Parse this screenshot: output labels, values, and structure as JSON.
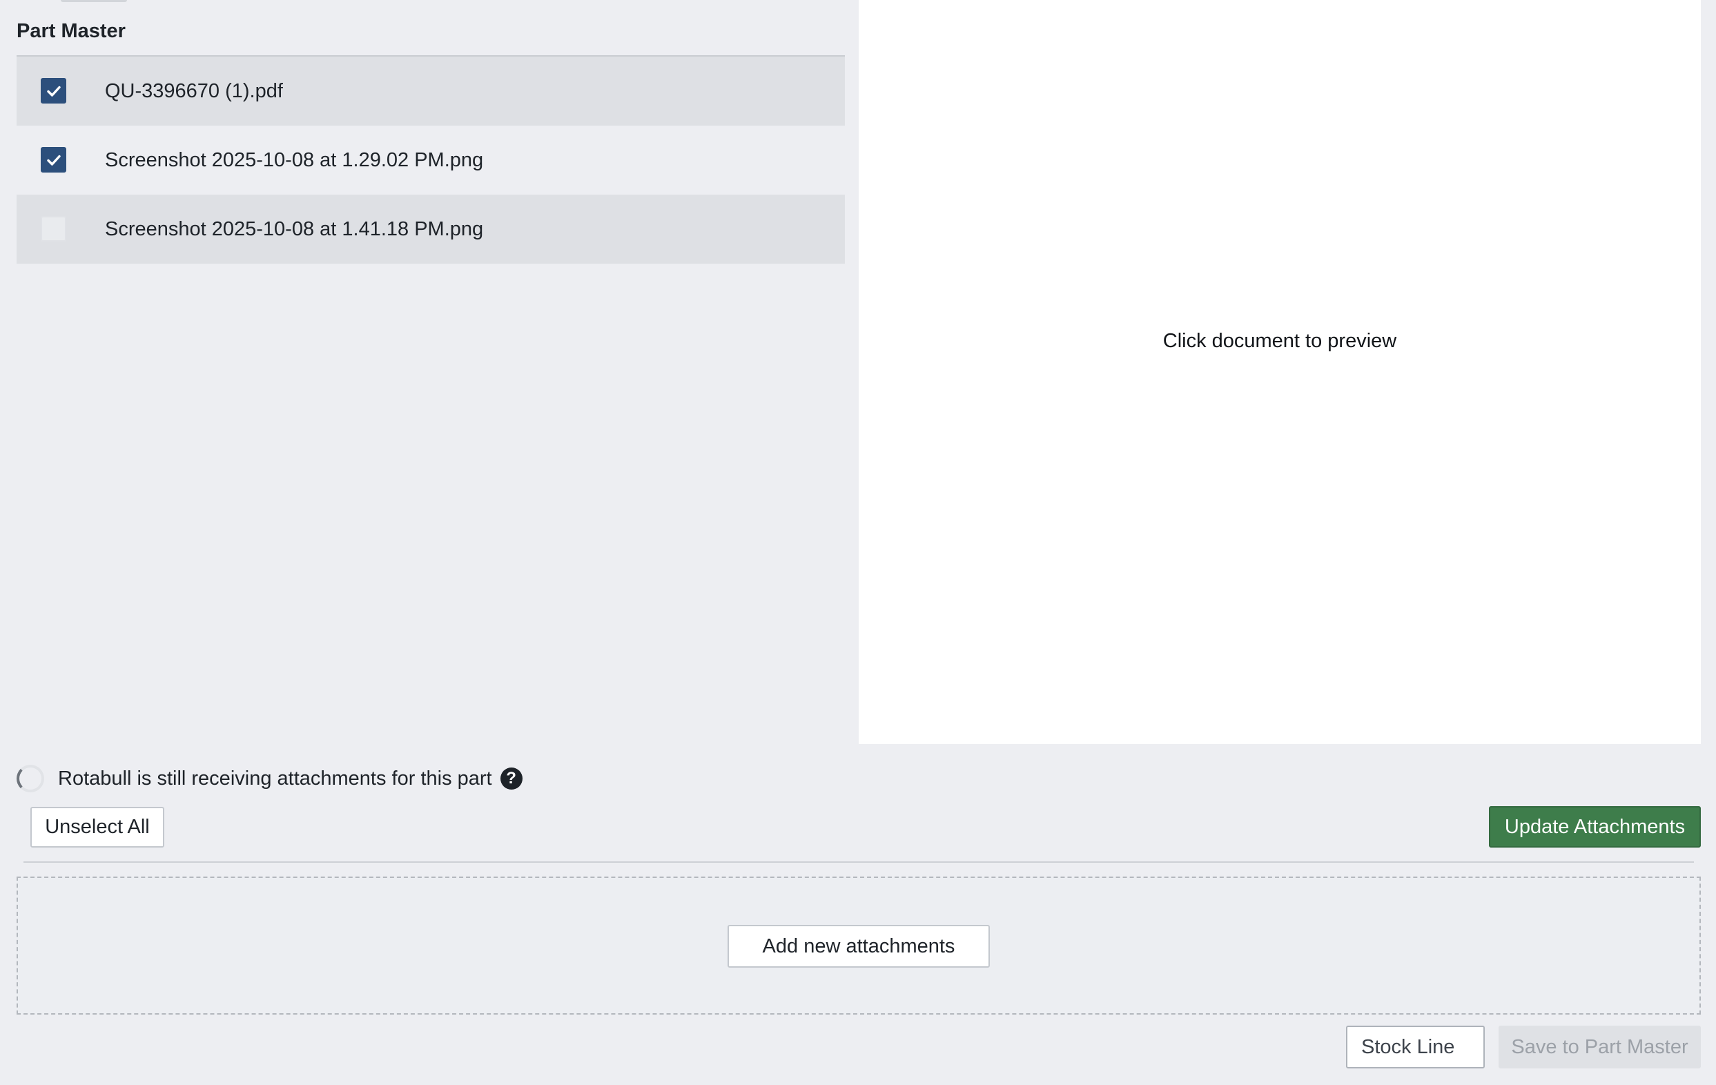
{
  "section": {
    "title": "Part Master"
  },
  "attachments": [
    {
      "name": "QU-3396670 (1).pdf",
      "checked": true
    },
    {
      "name": "Screenshot 2025-10-08 at 1.29.02 PM.png",
      "checked": true
    },
    {
      "name": "Screenshot 2025-10-08 at 1.41.18 PM.png",
      "checked": false
    }
  ],
  "preview": {
    "placeholder": "Click document to preview"
  },
  "status": {
    "text": "Rotabull is still receiving attachments for this part",
    "spinner_icon": "loading-spinner-icon",
    "help_icon": "question-circle-icon",
    "help_glyph": "?"
  },
  "actions": {
    "unselect_all": "Unselect All",
    "update_attachments": "Update Attachments",
    "add_new": "Add new attachments",
    "save_to_part_master": "Save to Part Master"
  },
  "stock_line": {
    "value": "Stock Line"
  },
  "colors": {
    "checkbox_checked": "#2c4f7c",
    "primary_button": "#3e7d4b",
    "background": "#edeef2",
    "row_shaded": "#dee0e4"
  }
}
